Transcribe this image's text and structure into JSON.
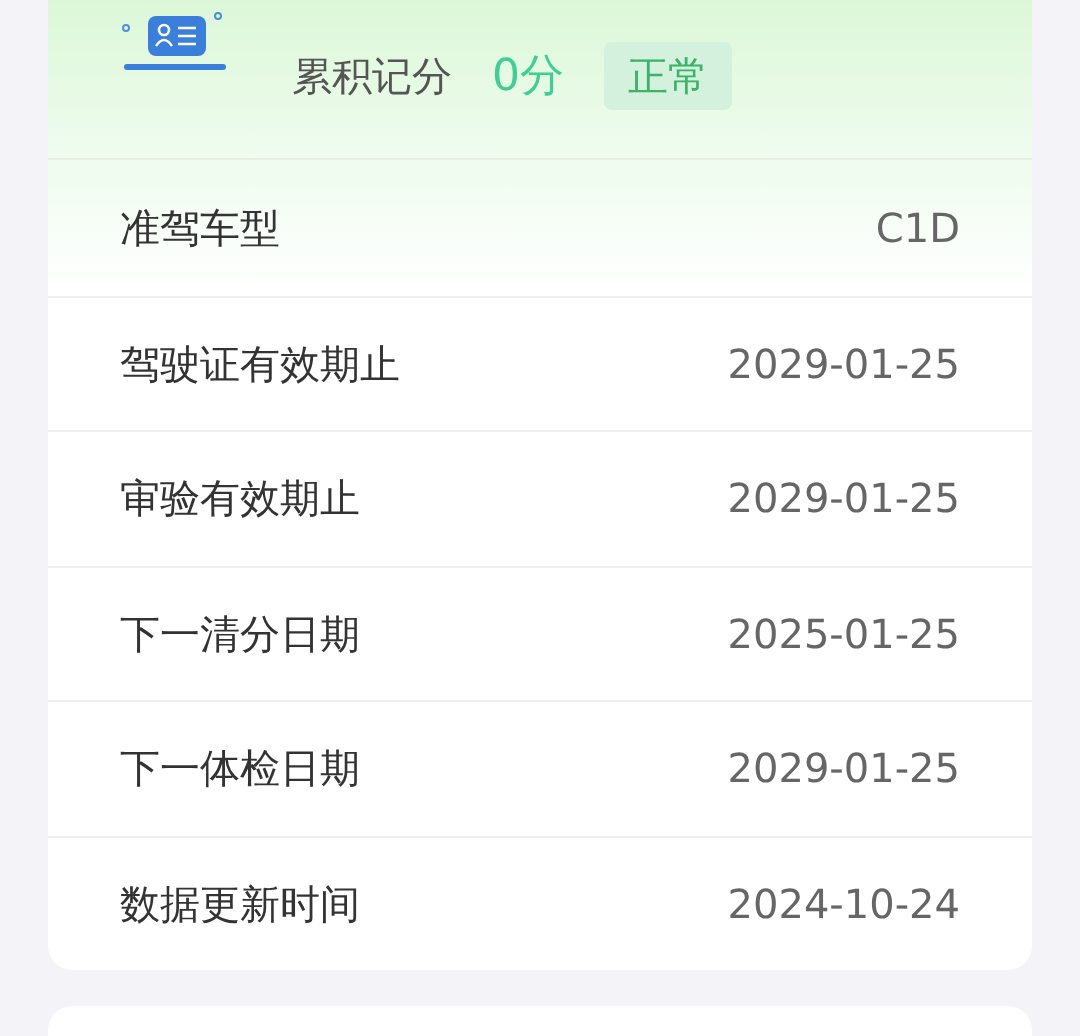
{
  "score": {
    "label": "累积记分",
    "value": "0分",
    "status": "正常"
  },
  "rows": [
    {
      "label": "准驾车型",
      "value": "C1D"
    },
    {
      "label": "驾驶证有效期止",
      "value": "2029-01-25"
    },
    {
      "label": "审验有效期止",
      "value": "2029-01-25"
    },
    {
      "label": "下一清分日期",
      "value": "2025-01-25"
    },
    {
      "label": "下一体检日期",
      "value": "2029-01-25"
    },
    {
      "label": "数据更新时间",
      "value": "2024-10-24"
    }
  ]
}
